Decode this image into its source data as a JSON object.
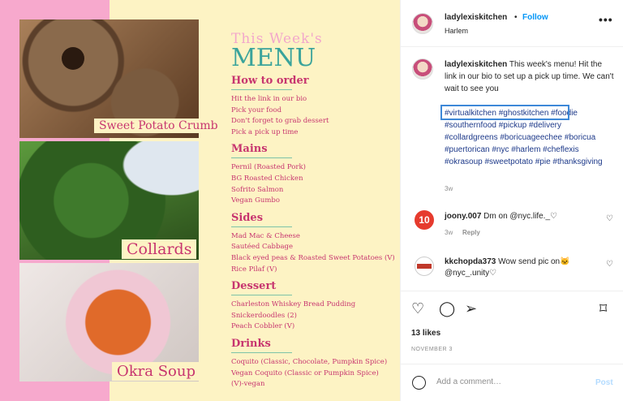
{
  "image": {
    "captions": [
      "Sweet Potato Crumb",
      "Collards",
      "Okra Soup"
    ],
    "menu": {
      "title_small": "This Week's",
      "title_big": "MENU",
      "sections": [
        {
          "name": "How to order",
          "items": [
            "Hit the link in our bio",
            "Pick your food",
            "Don't forget to grab dessert",
            "Pick a pick up time"
          ]
        },
        {
          "name": "Mains",
          "items": [
            "Pernil (Roasted Pork)",
            "BG Roasted Chicken",
            "Sofrito Salmon",
            "Vegan Gumbo"
          ]
        },
        {
          "name": "Sides",
          "items": [
            "Mad Mac & Cheese",
            "Sautéed Cabbage",
            "Black eyed peas & Roasted Sweet Potatoes (V)",
            "Rice Pilaf (V)"
          ]
        },
        {
          "name": "Dessert",
          "items": [
            "Charleston Whiskey Bread Pudding",
            "Snickerdoodles (2)",
            "Peach Cobbler (V)"
          ]
        },
        {
          "name": "Drinks",
          "items": [
            "Coquito (Classic, Chocolate, Pumpkin Spice)",
            "Vegan Coquito (Classic or Pumpkin Spice)",
            "(V)-vegan"
          ]
        }
      ]
    }
  },
  "header": {
    "username": "ladylexiskitchen",
    "separator": "•",
    "follow": "Follow",
    "location": "Harlem",
    "more": "•••"
  },
  "caption": {
    "username": "ladylexiskitchen",
    "text": "This week's menu! Hit the link in our bio to set up a pick up time. We can't wait to see you",
    "hashtags": "#virtualkitchen #ghostkitchen #foodie #southernfood #pickup #delivery #collardgreens #boricuageechee #boricua #puertorican #nyc #harlem #cheflexis #okrasoup #sweetpotato #pie #thanksgiving",
    "time": "3w"
  },
  "comments": [
    {
      "avatar_text": "10",
      "username": "joony.007",
      "text": "Dm on @nyc.life._♡",
      "time": "3w",
      "reply": "Reply"
    },
    {
      "username": "kkchopda373",
      "text": "Wow send pic on🐱 @nyc_.unity♡",
      "time": "3w",
      "reply": "Reply"
    }
  ],
  "actions": {
    "icons": [
      "heart-outline-icon",
      "comment-icon",
      "share-icon",
      "bookmark-icon"
    ],
    "likes": "13 likes",
    "date": "NOVEMBER 3"
  },
  "add_comment": {
    "placeholder": "Add a comment…",
    "post": "Post"
  },
  "colors": {
    "accent": "#0095f6",
    "menu_pink": "#c7356f",
    "menu_teal": "#3aa39b",
    "highlight_box": "#3d88d8"
  }
}
